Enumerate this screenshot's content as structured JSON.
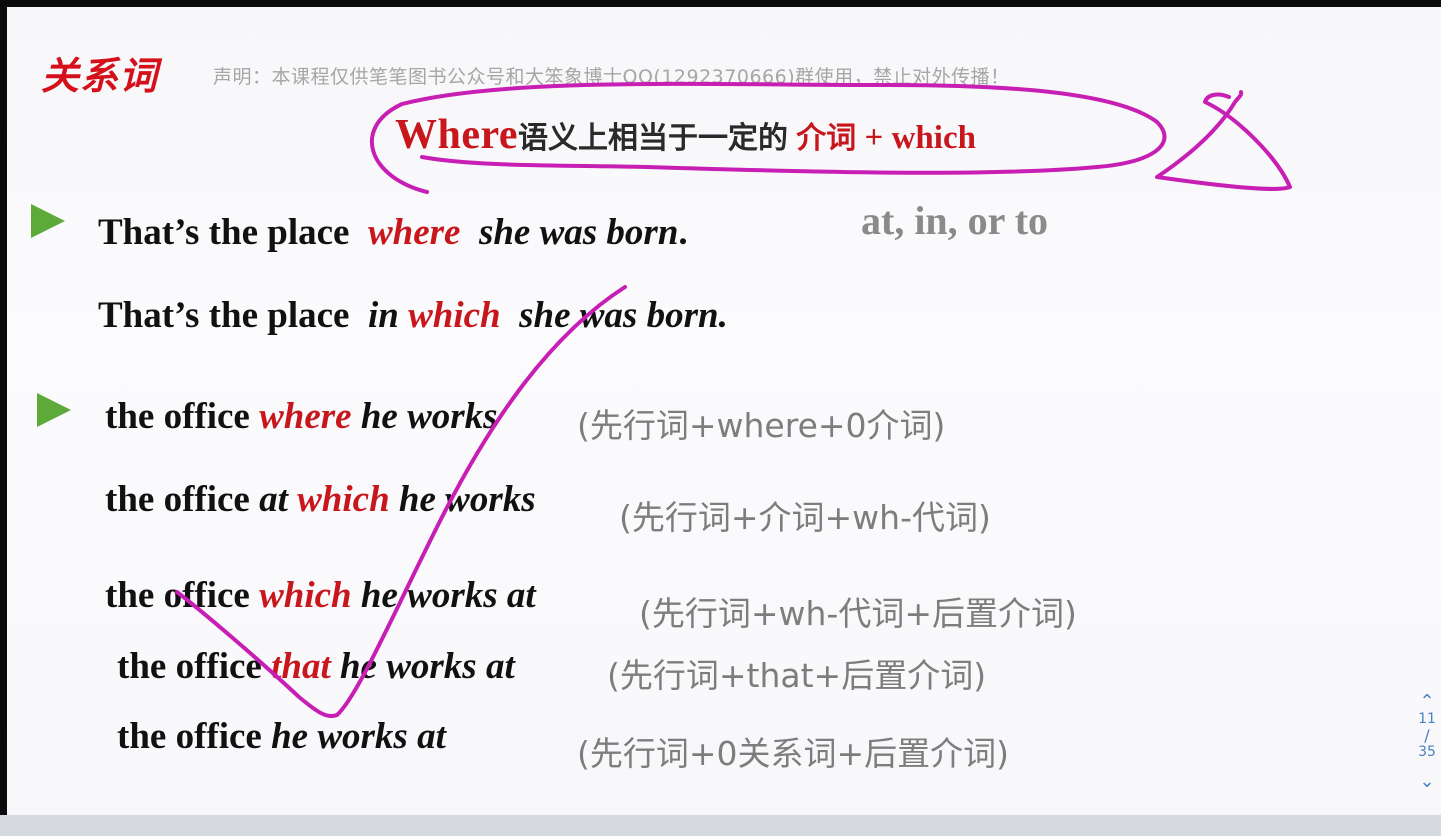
{
  "slide": {
    "title": "关系词",
    "disclaimer": "声明：本课程仅供笔笔图书公众号和大笨象博士QQ(1292370666)群使用，禁止对外传播！",
    "headline": {
      "where": "Where",
      "meaning": "语义上相当于一定的",
      "prep": "介词",
      "plus": "+",
      "which": "which"
    },
    "prepositions": "at, in, or to",
    "sentences": [
      {
        "a": "That’s the place",
        "b": "where",
        "c": "she was born",
        "d": "."
      },
      {
        "a": "That’s  the place",
        "b0": "in",
        "b": "which",
        "c": "she was born."
      },
      {
        "a": "the office",
        "b": "where",
        "c": "he works",
        "note": "(先行词+where+0介词)"
      },
      {
        "a": "the office",
        "b0": "at",
        "b": "which",
        "c": "he works",
        "note": "(先行词+介词+wh-代词)"
      },
      {
        "a": "the office",
        "b": "which",
        "c": "he works at",
        "note": "(先行词+wh-代词+后置介词)"
      },
      {
        "a": "the office",
        "b": "that",
        "c": "he works at",
        "note": "(先行词+that+后置介词)"
      },
      {
        "a": "the office",
        "c": "he works at",
        "note": "(先行词+0关系词+后置介词)"
      }
    ]
  },
  "pager": {
    "up_icon": "chevron-up-icon",
    "current": "11",
    "separator": "/",
    "total": "35",
    "down_icon": "chevron-down-icon"
  },
  "colors": {
    "accent_red": "#c8161d",
    "ink_magenta": "#c71fb4",
    "bullet_green": "#5daa3a",
    "note_gray": "#7d7d7d",
    "pager_blue": "#4a7fc4"
  }
}
